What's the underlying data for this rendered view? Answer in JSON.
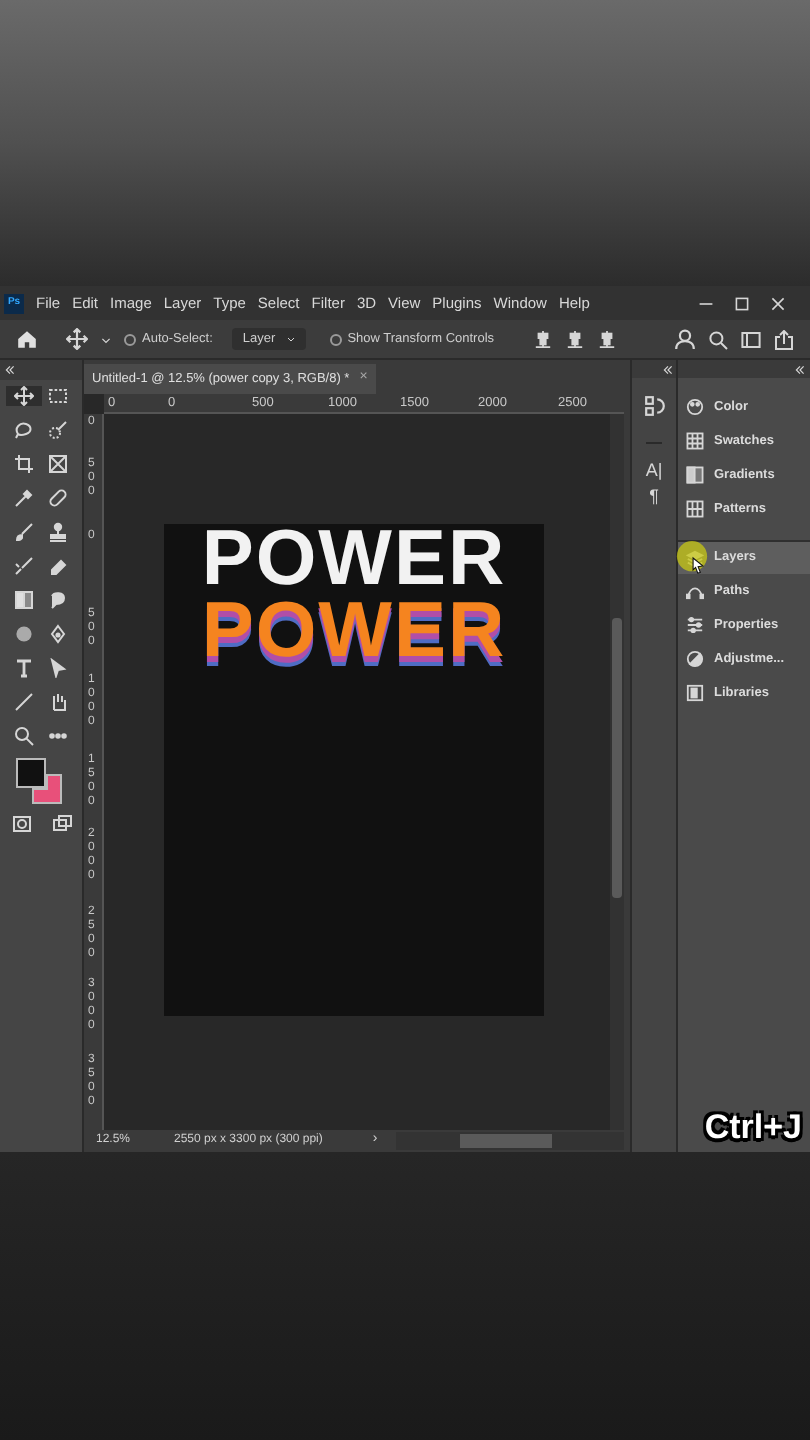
{
  "app_logo": "Ps",
  "menu_bar": [
    "File",
    "Edit",
    "Image",
    "Layer",
    "Type",
    "Select",
    "Filter",
    "3D",
    "View",
    "Plugins",
    "Window",
    "Help"
  ],
  "options_bar": {
    "auto_select": {
      "label": "Auto-Select:",
      "checked": false
    },
    "target_dropdown": "Layer",
    "show_transform_controls": {
      "label": "Show Transform Controls",
      "checked": false
    }
  },
  "document_tab": {
    "title": "Untitled-1 @ 12.5% (power copy 3, RGB/8) *",
    "close": "×"
  },
  "horizontal_ruler": [
    "0",
    "0",
    "500",
    "1000",
    "1500",
    "2000",
    "2500"
  ],
  "vertical_ruler": [
    "0",
    "500",
    "0",
    "500",
    "1000",
    "1500",
    "2000",
    "2500",
    "3000",
    "3500"
  ],
  "canvas": {
    "lines": [
      {
        "text": "POWER",
        "kind": "plain"
      },
      {
        "text": "POWER",
        "kind": "stacked"
      }
    ]
  },
  "color_swatches": [
    {
      "color": "#111111"
    },
    {
      "color": "#e8507a"
    }
  ],
  "character_panel_icons": [
    "A|",
    "¶"
  ],
  "panels": [
    {
      "label": "Color",
      "selected": false
    },
    {
      "label": "Swatches",
      "selected": false
    },
    {
      "label": "Gradients",
      "selected": false
    },
    {
      "label": "Patterns",
      "selected": false
    },
    {
      "label": "Layers",
      "selected": true
    },
    {
      "label": "Paths",
      "selected": false
    },
    {
      "label": "Properties",
      "selected": false
    },
    {
      "label": "Adjustme...",
      "selected": false
    },
    {
      "label": "Libraries",
      "selected": false
    }
  ],
  "status_bar": {
    "zoom": "12.5%",
    "document_size": "2550 px x 3300 px (300 ppi)",
    "arrow": "›"
  },
  "shortcut_caption": "Ctrl+J"
}
